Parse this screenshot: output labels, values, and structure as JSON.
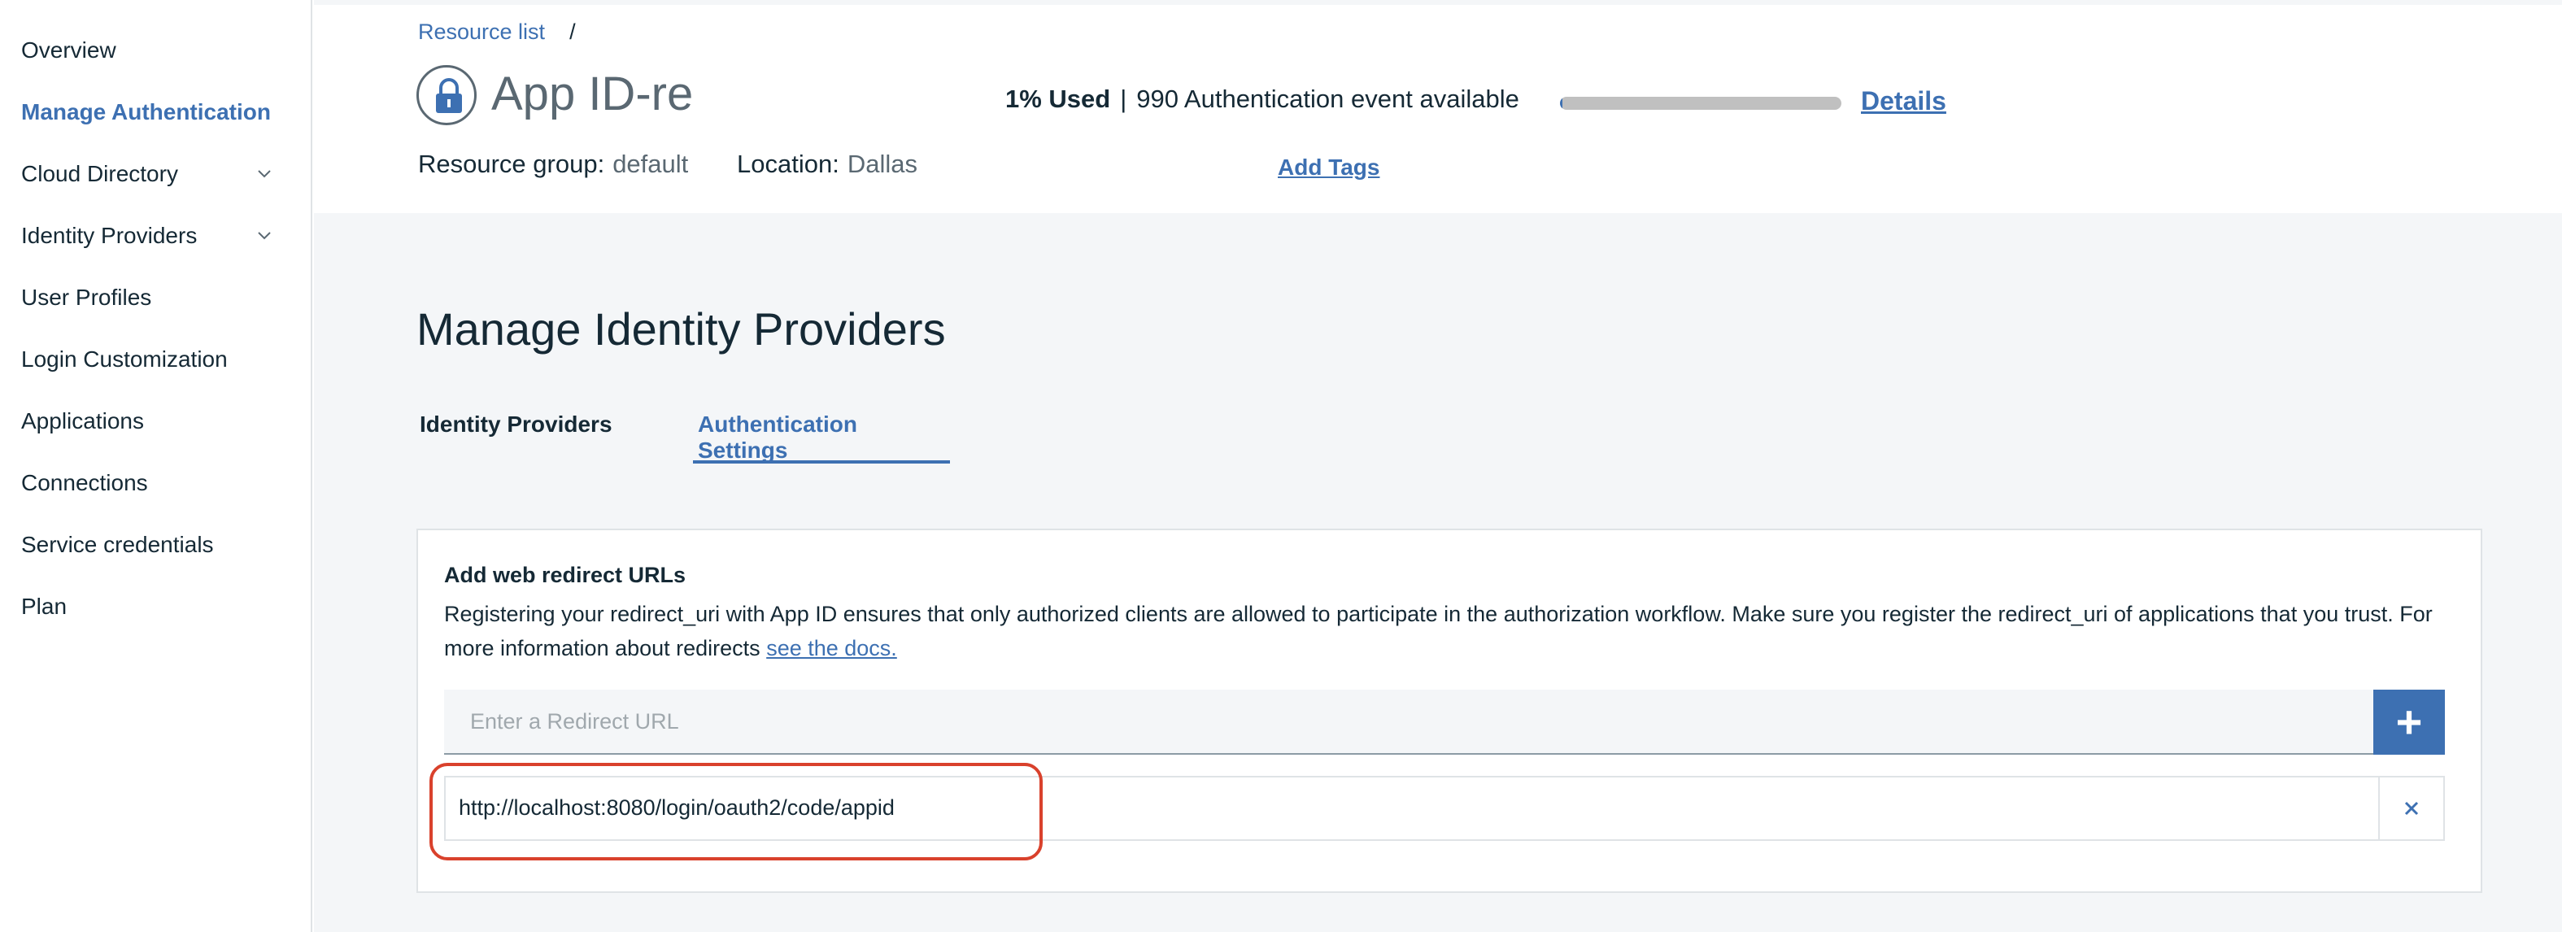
{
  "sidebar": {
    "items": [
      {
        "label": "Overview",
        "active": false,
        "has_chevron": false
      },
      {
        "label": "Manage Authentication",
        "active": true,
        "has_chevron": false
      },
      {
        "label": "Cloud Directory",
        "active": false,
        "has_chevron": true
      },
      {
        "label": "Identity Providers",
        "active": false,
        "has_chevron": true
      },
      {
        "label": "User Profiles",
        "active": false,
        "has_chevron": false
      },
      {
        "label": "Login Customization",
        "active": false,
        "has_chevron": false
      },
      {
        "label": "Applications",
        "active": false,
        "has_chevron": false
      },
      {
        "label": "Connections",
        "active": false,
        "has_chevron": false
      },
      {
        "label": "Service credentials",
        "active": false,
        "has_chevron": false
      },
      {
        "label": "Plan",
        "active": false,
        "has_chevron": false
      }
    ]
  },
  "header": {
    "breadcrumb": {
      "link": "Resource list",
      "separator": "/"
    },
    "app_icon": "lock-icon",
    "title": "App ID-re",
    "usage": {
      "percent_label": "1% Used",
      "separator": "|",
      "available": "990 Authentication event available",
      "fraction_used": 0.01
    },
    "details_link": "Details",
    "resource_group": {
      "label": "Resource group:",
      "value": "default"
    },
    "location": {
      "label": "Location:",
      "value": "Dallas"
    },
    "add_tags": "Add Tags"
  },
  "main": {
    "title": "Manage Identity Providers",
    "tabs": [
      {
        "label": "Identity Providers",
        "active": false
      },
      {
        "label": "Authentication Settings",
        "active": true
      }
    ],
    "card": {
      "title": "Add web redirect URLs",
      "description": "Registering your redirect_uri with App ID ensures that only authorized clients are allowed to participate in the authorization workflow. Make sure you register the redirect_uri of applications that you trust. For more information about redirects ",
      "docs_link": "see the docs.",
      "input_placeholder": "Enter a Redirect URL",
      "add_button_icon": "plus-icon",
      "add_button_glyph": "+",
      "urls": [
        "http://localhost:8080/login/oauth2/code/appid"
      ],
      "remove_icon": "close-icon"
    }
  },
  "colors": {
    "accent": "#3d70b2",
    "text": "#152935",
    "muted": "#5a6872",
    "background": "#f4f6f8",
    "highlight": "#d9412c"
  }
}
